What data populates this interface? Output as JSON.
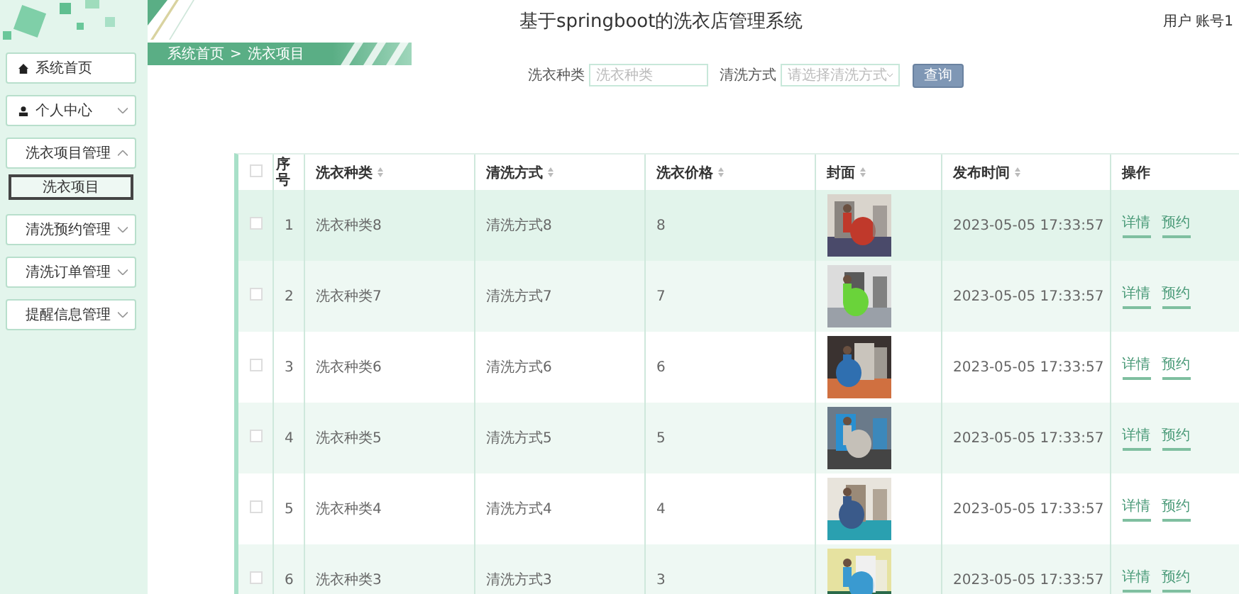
{
  "header": {
    "title": "基于springboot的洗衣店管理系统",
    "user": "用户 账号1"
  },
  "breadcrumb": [
    "系统首页",
    ">",
    "洗衣项目"
  ],
  "sidebar": {
    "items": [
      {
        "label": "系统首页"
      },
      {
        "label": "个人中心",
        "expanded": false
      },
      {
        "label": "洗衣项目管理",
        "expanded": true,
        "children": [
          {
            "label": "洗衣项目",
            "selected": true
          }
        ]
      },
      {
        "label": "清洗预约管理",
        "expanded": false
      },
      {
        "label": "清洗订单管理",
        "expanded": false
      },
      {
        "label": "提醒信息管理",
        "expanded": false
      }
    ]
  },
  "search": {
    "fields": [
      {
        "kind": "text",
        "label": "洗衣种类",
        "placeholder": "洗衣种类"
      },
      {
        "kind": "select",
        "label": "清洗方式",
        "placeholder": "请选择清洗方式"
      }
    ],
    "button": "查询"
  },
  "table": {
    "select_all_checked": false,
    "columns": [
      "序号",
      "洗衣种类",
      "清洗方式",
      "洗衣价格",
      "封面",
      "发布时间",
      "操作"
    ],
    "sortable": [
      false,
      true,
      true,
      true,
      true,
      true,
      false
    ],
    "rows": [
      {
        "checked": false,
        "hovered": true,
        "no": "1",
        "type": "洗衣种类8",
        "method": "清洗方式8",
        "price": "8",
        "time": "2023-05-05 17:33:57",
        "actions": [
          "详情",
          "预约"
        ]
      },
      {
        "checked": false,
        "hovered": false,
        "no": "2",
        "type": "洗衣种类7",
        "method": "清洗方式7",
        "price": "7",
        "time": "2023-05-05 17:33:57",
        "actions": [
          "详情",
          "预约"
        ]
      },
      {
        "checked": false,
        "hovered": false,
        "no": "3",
        "type": "洗衣种类6",
        "method": "清洗方式6",
        "price": "6",
        "time": "2023-05-05 17:33:57",
        "actions": [
          "详情",
          "预约"
        ]
      },
      {
        "checked": false,
        "hovered": false,
        "no": "4",
        "type": "洗衣种类5",
        "method": "清洗方式5",
        "price": "5",
        "time": "2023-05-05 17:33:57",
        "actions": [
          "详情",
          "预约"
        ]
      },
      {
        "checked": false,
        "hovered": false,
        "no": "5",
        "type": "洗衣种类4",
        "method": "清洗方式4",
        "price": "4",
        "time": "2023-05-05 17:33:57",
        "actions": [
          "详情",
          "预约"
        ]
      },
      {
        "checked": false,
        "hovered": false,
        "no": "6",
        "type": "洗衣种类3",
        "method": "清洗方式3",
        "price": "3",
        "time": "2023-05-05 17:33:57",
        "actions": [
          "详情",
          "预约"
        ]
      }
    ]
  }
}
